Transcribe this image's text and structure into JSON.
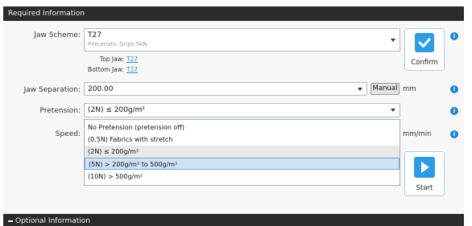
{
  "sections": {
    "required_title": "Required Information",
    "optional_title": "Optional Information"
  },
  "jaw_scheme": {
    "label": "Jaw Scheme:",
    "value": "T27",
    "subvalue": "Pneumatic Grips 5kN",
    "top_jaw_label": "Top Jaw:",
    "top_jaw_value": "T27",
    "bottom_jaw_label": "Bottom Jaw:",
    "bottom_jaw_value": "T27"
  },
  "confirm_button": {
    "label": "Confirm",
    "icon": "checkmark-icon"
  },
  "jaw_separation": {
    "label": "Jaw Separation:",
    "value": "200.00",
    "manual_label": "Manual",
    "unit": "mm"
  },
  "pretension": {
    "label": "Pretension:",
    "value": "(2N)  ≤ 200g/m²"
  },
  "speed": {
    "label": "Speed:",
    "unit": "mm/min"
  },
  "pretension_options": [
    {
      "label": "No Pretension (pretension off)",
      "state": "normal"
    },
    {
      "label": "(0.5N) Fabrics with stretch",
      "state": "normal"
    },
    {
      "label": "(2N)  ≤ 200g/m²",
      "state": "hovered"
    },
    {
      "label": "(5N)  > 200g/m² to 500g/m²",
      "state": "selected"
    },
    {
      "label": "(10N) > 500g/m²",
      "state": "normal"
    }
  ],
  "start_button": {
    "label": "Start",
    "icon": "play-icon"
  },
  "help_icon": "info-icon",
  "colors": {
    "section_bar": "#2b2b2b",
    "accent_blue": "#2a9de6",
    "link_blue": "#1b8fd6",
    "selected_option": "#cfe3f5"
  }
}
